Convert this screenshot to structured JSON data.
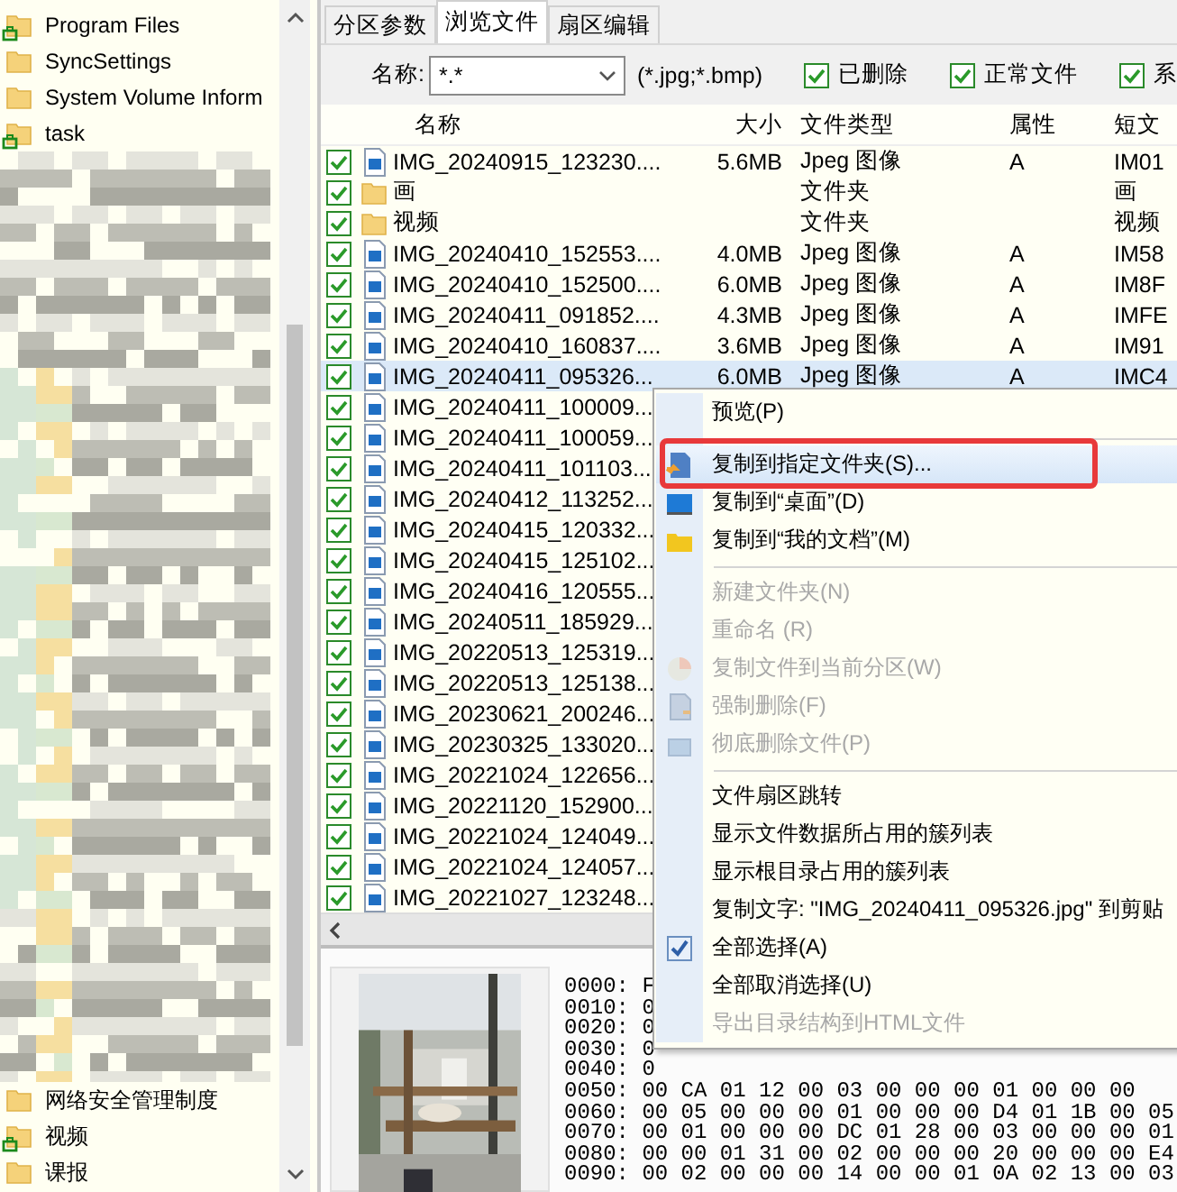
{
  "tree": {
    "top": [
      {
        "name": "Program Files",
        "marked": true
      },
      {
        "name": "SyncSettings",
        "marked": false
      },
      {
        "name": "System Volume Inform",
        "marked": false
      },
      {
        "name": "task",
        "marked": true
      }
    ],
    "bottom": [
      {
        "name": "网络安全管理制度",
        "marked": false
      },
      {
        "name": "视频",
        "marked": true
      },
      {
        "name": "课报",
        "marked": false
      }
    ]
  },
  "tabs": [
    {
      "label": "分区参数",
      "selected": false
    },
    {
      "label": "浏览文件",
      "selected": true
    },
    {
      "label": "扇区编辑",
      "selected": false
    }
  ],
  "filter": {
    "label": "名称:",
    "value": "*.*",
    "hint": "(*.jpg;*.bmp)",
    "options": [
      {
        "label": "已删除",
        "checked": true
      },
      {
        "label": "正常文件",
        "checked": true
      },
      {
        "label": "系",
        "checked": true
      }
    ]
  },
  "columns": [
    "名称",
    "大小",
    "文件类型",
    "属性",
    "短文"
  ],
  "files": [
    {
      "kind": "file",
      "checked": true,
      "selected": false,
      "name": "IMG_20240915_123230....",
      "size": "5.6MB",
      "type": "Jpeg 图像",
      "attr": "A",
      "short": "IM01"
    },
    {
      "kind": "folder",
      "checked": true,
      "selected": false,
      "name": "画",
      "type": "文件夹",
      "short": "画"
    },
    {
      "kind": "folder",
      "checked": true,
      "selected": false,
      "name": "视频",
      "type": "文件夹",
      "short": "视频"
    },
    {
      "kind": "file",
      "checked": true,
      "selected": false,
      "name": "IMG_20240410_152553....",
      "size": "4.0MB",
      "type": "Jpeg 图像",
      "attr": "A",
      "short": "IM58"
    },
    {
      "kind": "file",
      "checked": true,
      "selected": false,
      "name": "IMG_20240410_152500....",
      "size": "6.0MB",
      "type": "Jpeg 图像",
      "attr": "A",
      "short": "IM8F"
    },
    {
      "kind": "file",
      "checked": true,
      "selected": false,
      "name": "IMG_20240411_091852....",
      "size": "4.3MB",
      "type": "Jpeg 图像",
      "attr": "A",
      "short": "IMFE"
    },
    {
      "kind": "file",
      "checked": true,
      "selected": false,
      "name": "IMG_20240410_160837....",
      "size": "3.6MB",
      "type": "Jpeg 图像",
      "attr": "A",
      "short": "IM91"
    },
    {
      "kind": "file",
      "checked": true,
      "selected": true,
      "name": "IMG_20240411_095326...",
      "size": "6.0MB",
      "type": "Jpeg 图像",
      "attr": "A",
      "short": "IMC4"
    },
    {
      "kind": "file",
      "checked": true,
      "selected": false,
      "name": "IMG_20240411_100009..."
    },
    {
      "kind": "file",
      "checked": true,
      "selected": false,
      "name": "IMG_20240411_100059..."
    },
    {
      "kind": "file",
      "checked": true,
      "selected": false,
      "name": "IMG_20240411_101103..."
    },
    {
      "kind": "file",
      "checked": true,
      "selected": false,
      "name": "IMG_20240412_113252..."
    },
    {
      "kind": "file",
      "checked": true,
      "selected": false,
      "name": "IMG_20240415_120332..."
    },
    {
      "kind": "file",
      "checked": true,
      "selected": false,
      "name": "IMG_20240415_125102..."
    },
    {
      "kind": "file",
      "checked": true,
      "selected": false,
      "name": "IMG_20240416_120555..."
    },
    {
      "kind": "file",
      "checked": true,
      "selected": false,
      "name": "IMG_20240511_185929..."
    },
    {
      "kind": "file",
      "checked": true,
      "selected": false,
      "name": "IMG_20220513_125319..."
    },
    {
      "kind": "file",
      "checked": true,
      "selected": false,
      "name": "IMG_20220513_125138..."
    },
    {
      "kind": "file",
      "checked": true,
      "selected": false,
      "name": "IMG_20230621_200246..."
    },
    {
      "kind": "file",
      "checked": true,
      "selected": false,
      "name": "IMG_20230325_133020..."
    },
    {
      "kind": "file",
      "checked": true,
      "selected": false,
      "name": "IMG_20221024_122656..."
    },
    {
      "kind": "file",
      "checked": true,
      "selected": false,
      "name": "IMG_20221120_152900..."
    },
    {
      "kind": "file",
      "checked": true,
      "selected": false,
      "name": "IMG_20221024_124049..."
    },
    {
      "kind": "file",
      "checked": true,
      "selected": false,
      "name": "IMG_20221024_124057..."
    },
    {
      "kind": "file",
      "checked": true,
      "selected": false,
      "name": "IMG_20221027_123248..."
    }
  ],
  "hex": [
    "0000: F",
    "0010: 0",
    "0020: 0",
    "0030: 0",
    "0040: 0",
    "0050: 00 CA 01 12 00 03 00 00 00 01 00 00 00",
    "0060: 00 05 00 00 00 01 00 00 00 D4 01 1B 00 05",
    "0070: 00 01 00 00 00 DC 01 28 00 03 00 00 00 01",
    "0080: 00 00 01 31 00 02 00 00 00 20 00 00 00 E4",
    "0090: 00 02 00 00 00 14 00 00 01 0A 02 13 00 03"
  ],
  "menu": {
    "items": [
      {
        "kind": "item",
        "label": "预览(P)",
        "disabled": false,
        "selected": false
      },
      {
        "kind": "separator"
      },
      {
        "kind": "item",
        "label": "复制到指定文件夹(S)...",
        "disabled": false,
        "selected": true,
        "annotated": true
      },
      {
        "kind": "item",
        "label": "复制到“桌面”(D)",
        "disabled": false,
        "selected": false
      },
      {
        "kind": "item",
        "label": "复制到“我的文档”(M)",
        "disabled": false,
        "selected": false
      },
      {
        "kind": "separator"
      },
      {
        "kind": "item",
        "label": "新建文件夹(N)",
        "disabled": true,
        "selected": false
      },
      {
        "kind": "item",
        "label": "重命名 (R)",
        "disabled": true,
        "selected": false
      },
      {
        "kind": "item",
        "label": "复制文件到当前分区(W)",
        "disabled": true,
        "selected": false
      },
      {
        "kind": "item",
        "label": "强制删除(F)",
        "disabled": true,
        "selected": false
      },
      {
        "kind": "item",
        "label": "彻底删除文件(P)",
        "disabled": true,
        "selected": false
      },
      {
        "kind": "separator"
      },
      {
        "kind": "item",
        "label": "文件扇区跳转",
        "disabled": false,
        "selected": false
      },
      {
        "kind": "item",
        "label": "显示文件数据所占用的簇列表",
        "disabled": false,
        "selected": false
      },
      {
        "kind": "item",
        "label": "显示根目录占用的簇列表",
        "disabled": false,
        "selected": false
      },
      {
        "kind": "item",
        "label": "复制文字: \"IMG_20240411_095326.jpg\" 到剪贴",
        "disabled": false,
        "selected": false
      },
      {
        "kind": "item",
        "label": "全部选择(A)",
        "disabled": false,
        "selected": false
      },
      {
        "kind": "item",
        "label": "全部取消选择(U)",
        "disabled": false,
        "selected": false
      },
      {
        "kind": "item",
        "label": "导出目录结构到HTML文件",
        "disabled": true,
        "selected": false
      }
    ]
  }
}
